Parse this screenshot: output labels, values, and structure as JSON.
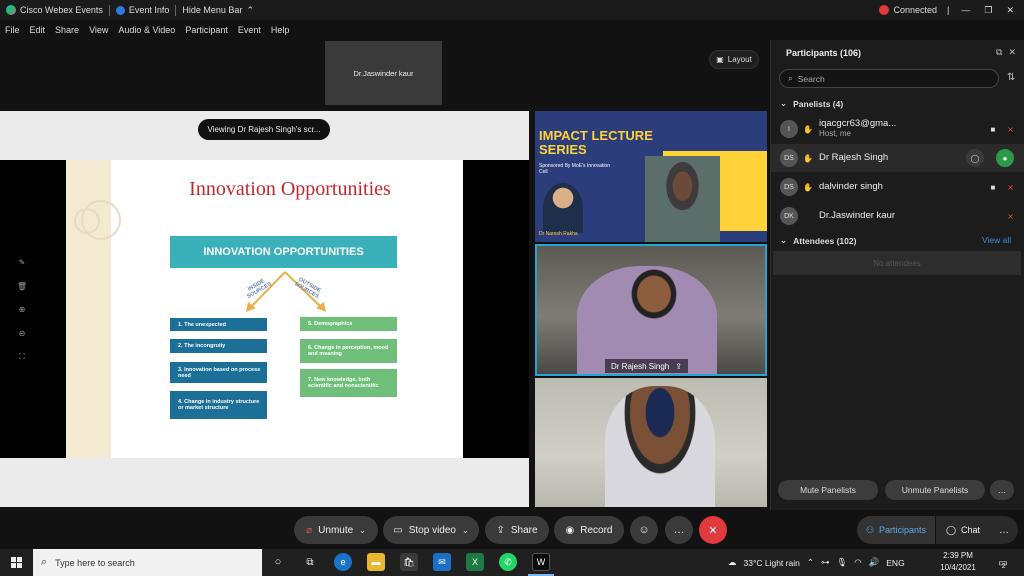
{
  "titlebar": {
    "app_name": "Cisco Webex Events",
    "event_info": "Event Info",
    "hide_menu": "Hide Menu Bar",
    "status": "Connected"
  },
  "menu": [
    "File",
    "Edit",
    "Share",
    "View",
    "Audio & Video",
    "Participant",
    "Event",
    "Help"
  ],
  "stage": {
    "active_name": "Dr.Jaswinder kaur",
    "layout_label": "Layout",
    "viewing_label": "Viewing Dr Rajesh Singh's scr..."
  },
  "slide": {
    "title": "Innovation Opportunities",
    "banner": "INNOVATION OPPORTUNITIES",
    "inside_label": "INSIDE SOURCES",
    "outside_label": "OUTSIDE SOURCES",
    "inside_items": [
      "1. The unexpected",
      "2. The incongruity",
      "3. Innovation based on process need",
      "4. Change in industry structure or market structure"
    ],
    "outside_items": [
      "5. Demographics",
      "6. Change in perception, mood and meaning",
      "7. New knowledge, both scientific and nonscientific"
    ]
  },
  "poster": {
    "title": "IMPACT LECTURE SERIES",
    "sponsor": "Sponsored By MoE's Innovation Cell",
    "speaker": "Dr Naresh Rakha"
  },
  "video": {
    "speaker_name": "Dr Rajesh Singh"
  },
  "panel": {
    "title": "Participants (106)",
    "search_placeholder": "Search",
    "panelists_header": "Panelists (4)",
    "panelists": [
      {
        "initials": "I",
        "name": "iqacgcr63@gma...",
        "sub": "Host, me"
      },
      {
        "initials": "DS",
        "name": "Dr Rajesh Singh",
        "sub": ""
      },
      {
        "initials": "DS",
        "name": "dalvinder singh",
        "sub": ""
      },
      {
        "initials": "DK",
        "name": "Dr.Jaswinder kaur",
        "sub": ""
      }
    ],
    "attendees_header": "Attendees (102)",
    "view_all": "View all",
    "no_attendees": "No attendees",
    "mute_panelists": "Mute Panelists",
    "unmute_panelists": "Unmute Panelists"
  },
  "controls": {
    "unmute": "Unmute",
    "stop_video": "Stop video",
    "share": "Share",
    "record": "Record",
    "participants": "Participants",
    "chat": "Chat"
  },
  "taskbar": {
    "search_placeholder": "Type here to search",
    "weather": "33°C  Light rain",
    "language": "ENG",
    "time": "2:39 PM",
    "date": "10/4/2021",
    "notifications": "2"
  },
  "colors": {
    "accent": "#27a3d4",
    "end_red": "#e0393e",
    "slide_title": "#c0282e",
    "banner_teal": "#3ab0b8"
  }
}
